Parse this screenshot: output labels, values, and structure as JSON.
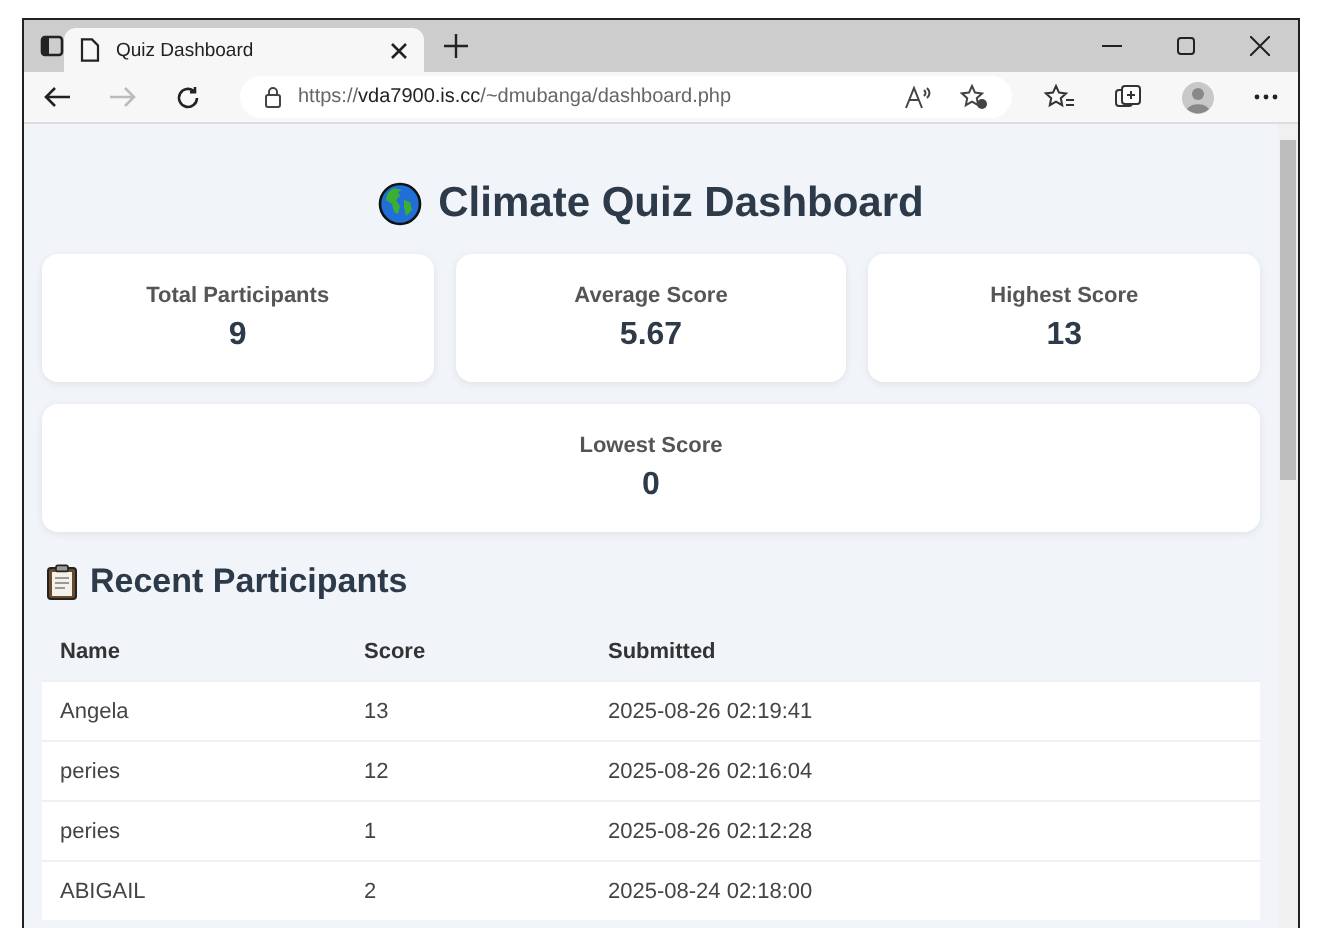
{
  "browser": {
    "tab_title": "Quiz Dashboard",
    "url": {
      "scheme": "https://",
      "host": "vda7900.is.cc",
      "path": "/~dmubanga/dashboard.php"
    }
  },
  "page": {
    "title": "Climate Quiz Dashboard",
    "stats": [
      {
        "label": "Total Participants",
        "value": "9"
      },
      {
        "label": "Average Score",
        "value": "5.67"
      },
      {
        "label": "Highest Score",
        "value": "13"
      },
      {
        "label": "Lowest Score",
        "value": "0"
      }
    ],
    "section_title": "Recent Participants",
    "table": {
      "columns": [
        "Name",
        "Score",
        "Submitted"
      ],
      "rows": [
        [
          "Angela",
          "13",
          "2025-08-26 02:19:41"
        ],
        [
          "peries",
          "12",
          "2025-08-26 02:16:04"
        ],
        [
          "peries",
          "1",
          "2025-08-26 02:12:28"
        ],
        [
          "ABIGAIL",
          "2",
          "2025-08-24 02:18:00"
        ]
      ]
    }
  }
}
